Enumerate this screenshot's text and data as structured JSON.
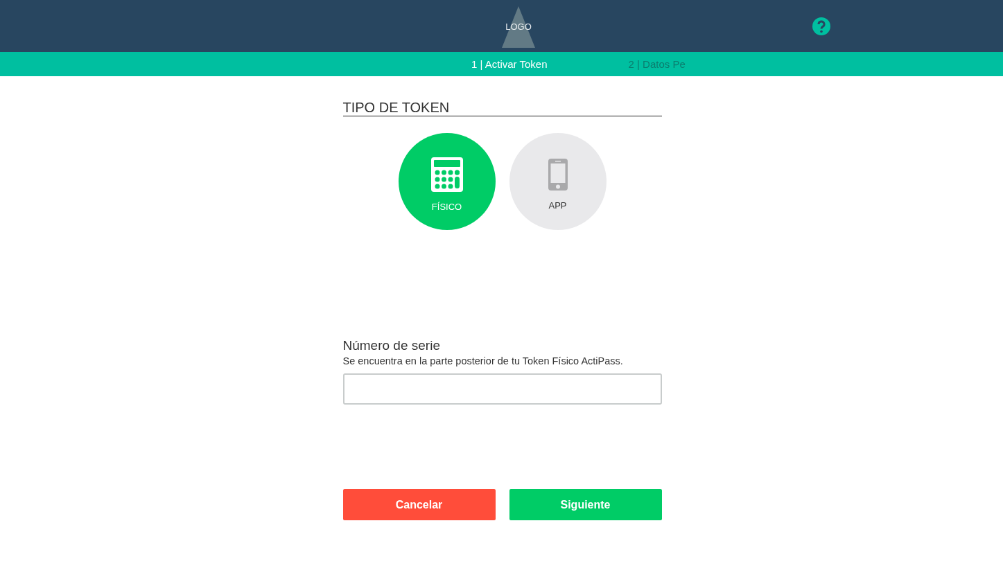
{
  "header": {
    "logo": "LOGO"
  },
  "steps": [
    {
      "label": "1 | Activar Token",
      "selected": true
    },
    {
      "label": "2 | Datos Pe",
      "selected": false
    }
  ],
  "token_type": {
    "title": "TIPO DE TOKEN",
    "options": [
      {
        "kind": "calculator",
        "label": "FÍSICO",
        "selected": true
      },
      {
        "kind": "phone",
        "label": "APP",
        "selected": false
      }
    ]
  },
  "serial": {
    "label": "Número de serie",
    "hint": "Se encuentra en la parte posterior de tu Token Físico ActiPass."
  },
  "buttons": [
    {
      "kind": "cancel",
      "label": "Cancelar"
    },
    {
      "kind": "next",
      "label": "Siguiente"
    }
  ]
}
